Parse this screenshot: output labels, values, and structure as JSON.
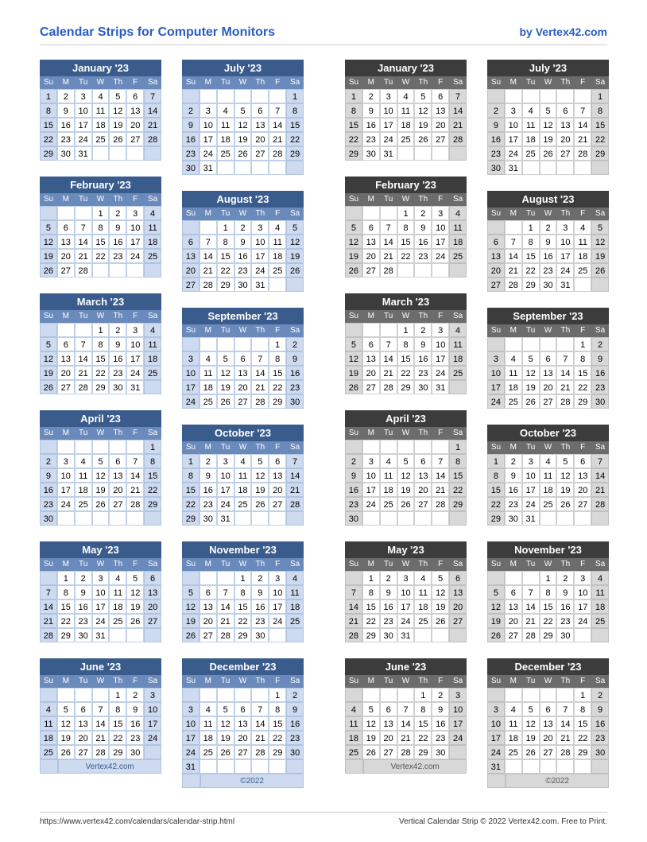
{
  "header": {
    "title": "Calendar Strips for Computer Monitors",
    "byline": "by Vertex42.com"
  },
  "dow": [
    "Su",
    "M",
    "Tu",
    "W",
    "Th",
    "F",
    "Sa"
  ],
  "themes": [
    "blue",
    "gray"
  ],
  "columns": [
    [
      {
        "name": "January '23",
        "start": 0,
        "days": 31,
        "credit": null
      },
      {
        "name": "February '23",
        "start": 3,
        "days": 28,
        "credit": null
      },
      {
        "name": "March '23",
        "start": 3,
        "days": 31,
        "credit": null
      },
      {
        "name": "April '23",
        "start": 6,
        "days": 30,
        "credit": null
      },
      {
        "name": "May '23",
        "start": 1,
        "days": 31,
        "credit": null
      },
      {
        "name": "June '23",
        "start": 4,
        "days": 30,
        "credit": "Vertex42.com"
      }
    ],
    [
      {
        "name": "July '23",
        "start": 6,
        "days": 31,
        "credit": null
      },
      {
        "name": "August '23",
        "start": 2,
        "days": 31,
        "credit": null
      },
      {
        "name": "September '23",
        "start": 5,
        "days": 30,
        "credit": null
      },
      {
        "name": "October '23",
        "start": 0,
        "days": 31,
        "credit": null
      },
      {
        "name": "November '23",
        "start": 3,
        "days": 30,
        "credit": null
      },
      {
        "name": "December '23",
        "start": 5,
        "days": 31,
        "credit": "©2022"
      }
    ]
  ],
  "footer": {
    "url": "https://www.vertex42.com/calendars/calendar-strip.html",
    "copyright": "Vertical Calendar Strip © 2022 Vertex42.com. Free to Print."
  }
}
